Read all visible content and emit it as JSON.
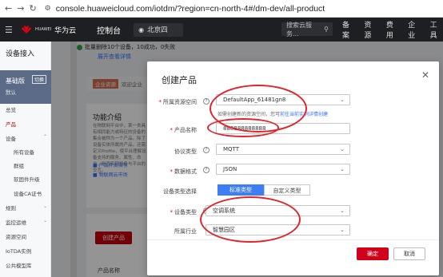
{
  "browser": {
    "url": "console.huaweicloud.com/iotdm/?region=cn-north-4#/dm-dev/all-product"
  },
  "topbar": {
    "brand": "HUAWEI",
    "cloud": "华为云",
    "console": "控制台",
    "region": "北京四",
    "search_placeholder": "搜索云服务...",
    "menus": [
      "备案",
      "资源",
      "费用",
      "企业",
      "工具"
    ]
  },
  "sidebar": {
    "title": "设备接入",
    "edition": "基础版",
    "switch_label": "切换",
    "default_label": "默认",
    "items": [
      {
        "label": "总览"
      },
      {
        "label": "产品"
      },
      {
        "label": "设备"
      },
      {
        "label": "所有设备"
      },
      {
        "label": "群组"
      },
      {
        "label": "软固件升级"
      },
      {
        "label": "设备CA证书"
      },
      {
        "label": "规则"
      },
      {
        "label": "监控运维"
      },
      {
        "label": "资源空间"
      },
      {
        "label": "IoTDA实例"
      },
      {
        "label": "公共模型库"
      }
    ]
  },
  "page": {
    "notice_msg": "批量删除10个设备，10成功，0失败",
    "notice_expand": "展开查看详情",
    "enterprise_tag": "企业资源",
    "enterprise_text": "欢迎企业",
    "func_title": "功能介绍",
    "func_text": "在物联网平台中，某一类具有相同能力或特征的设备的集合被称为一个产品。除了设备实体所属的产品，还需定义Profile，使平台理解设备支持的服务、属性、命令，是否实现设备与平台的交互。",
    "links": [
      "产品开发指引",
      "物联网云市场"
    ],
    "create_btn": "创建产品",
    "pname_col": "产品名称"
  },
  "dialog": {
    "title": "创建产品",
    "fields": {
      "space_label": "所属资源空间",
      "space_value": "DefaultApp_61481gn8",
      "space_hint": "如需创建新的资源空间，您可前往当前实例详情创建",
      "space_hint_link": "前往当前实例详情创建",
      "name_label": "产品名称",
      "name_value": "888888888888",
      "protocol_label": "协议类型",
      "protocol_value": "MQTT",
      "format_label": "数据格式",
      "format_value": "JSON",
      "type_select_label": "设备类型选择",
      "type_options": [
        "标准类型",
        "自定义类型"
      ],
      "device_type_label": "设备类型",
      "device_type_value": "空调系统",
      "industry_label": "所属行业",
      "industry_value": "智慧园区"
    },
    "ok": "确定",
    "cancel": "取消"
  },
  "colors": {
    "accent": "#c7000b",
    "primary_blue": "#3d7ef5",
    "annotation_ring": "#e2242b"
  }
}
